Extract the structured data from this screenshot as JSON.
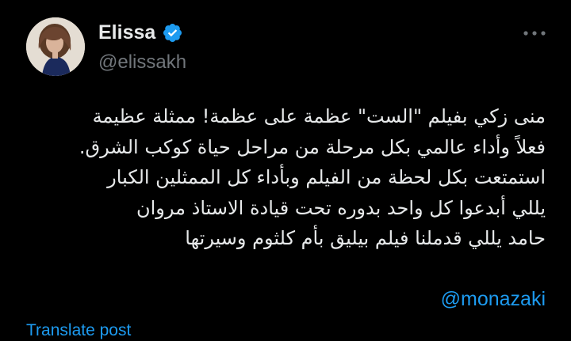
{
  "author": {
    "display_name": "Elissa",
    "handle": "@elissakh",
    "verified": true
  },
  "tweet": {
    "lines": [
      "منى زكي بفيلم \"الست\" عظمة على عظمة! ممثلة عظيمة",
      "فعلاً وأداء عالمي بكل مرحلة من مراحل حياة كوكب الشرق.",
      "استمتعت بكل لحظة من الفيلم وبأداء كل الممثلين الكبار",
      "يللي أبدعوا كل واحد بدوره تحت قيادة الاستاذ مروان",
      "حامد يللي قدملنا فيلم بيليق بأم كلثوم وسيرتها"
    ],
    "mention": "@monazaki"
  },
  "actions": {
    "translate_label": "Translate post"
  },
  "icons": {
    "verified": "verified-badge-icon",
    "more": "more-options-icon"
  },
  "colors": {
    "background": "#000000",
    "text_primary": "#e7e9ea",
    "text_secondary": "#71767b",
    "accent": "#1d9bf0"
  }
}
